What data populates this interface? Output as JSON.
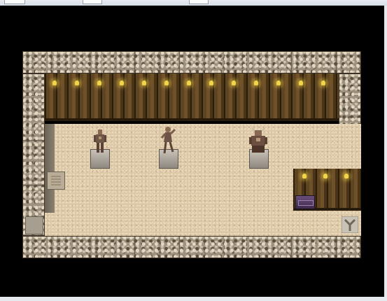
{
  "app": {
    "title": ""
  },
  "scene": {
    "type": "rpg-top-down-room",
    "statues": [
      {
        "name": "armored-knight-statue"
      },
      {
        "name": "dancer-statue"
      },
      {
        "name": "seated-warrior-statue"
      }
    ],
    "objects": [
      "wall-lamps",
      "treasure-chest",
      "exit-arrow-marker",
      "wall-plaque",
      "floor-switch"
    ]
  },
  "colors": {
    "background": "#000000",
    "floor": "#dcc8a7",
    "stone_border": "#9d917e",
    "wood_wall": "#4e3819",
    "lamp": "#f3d54a",
    "chest": "#6a4e7a"
  }
}
